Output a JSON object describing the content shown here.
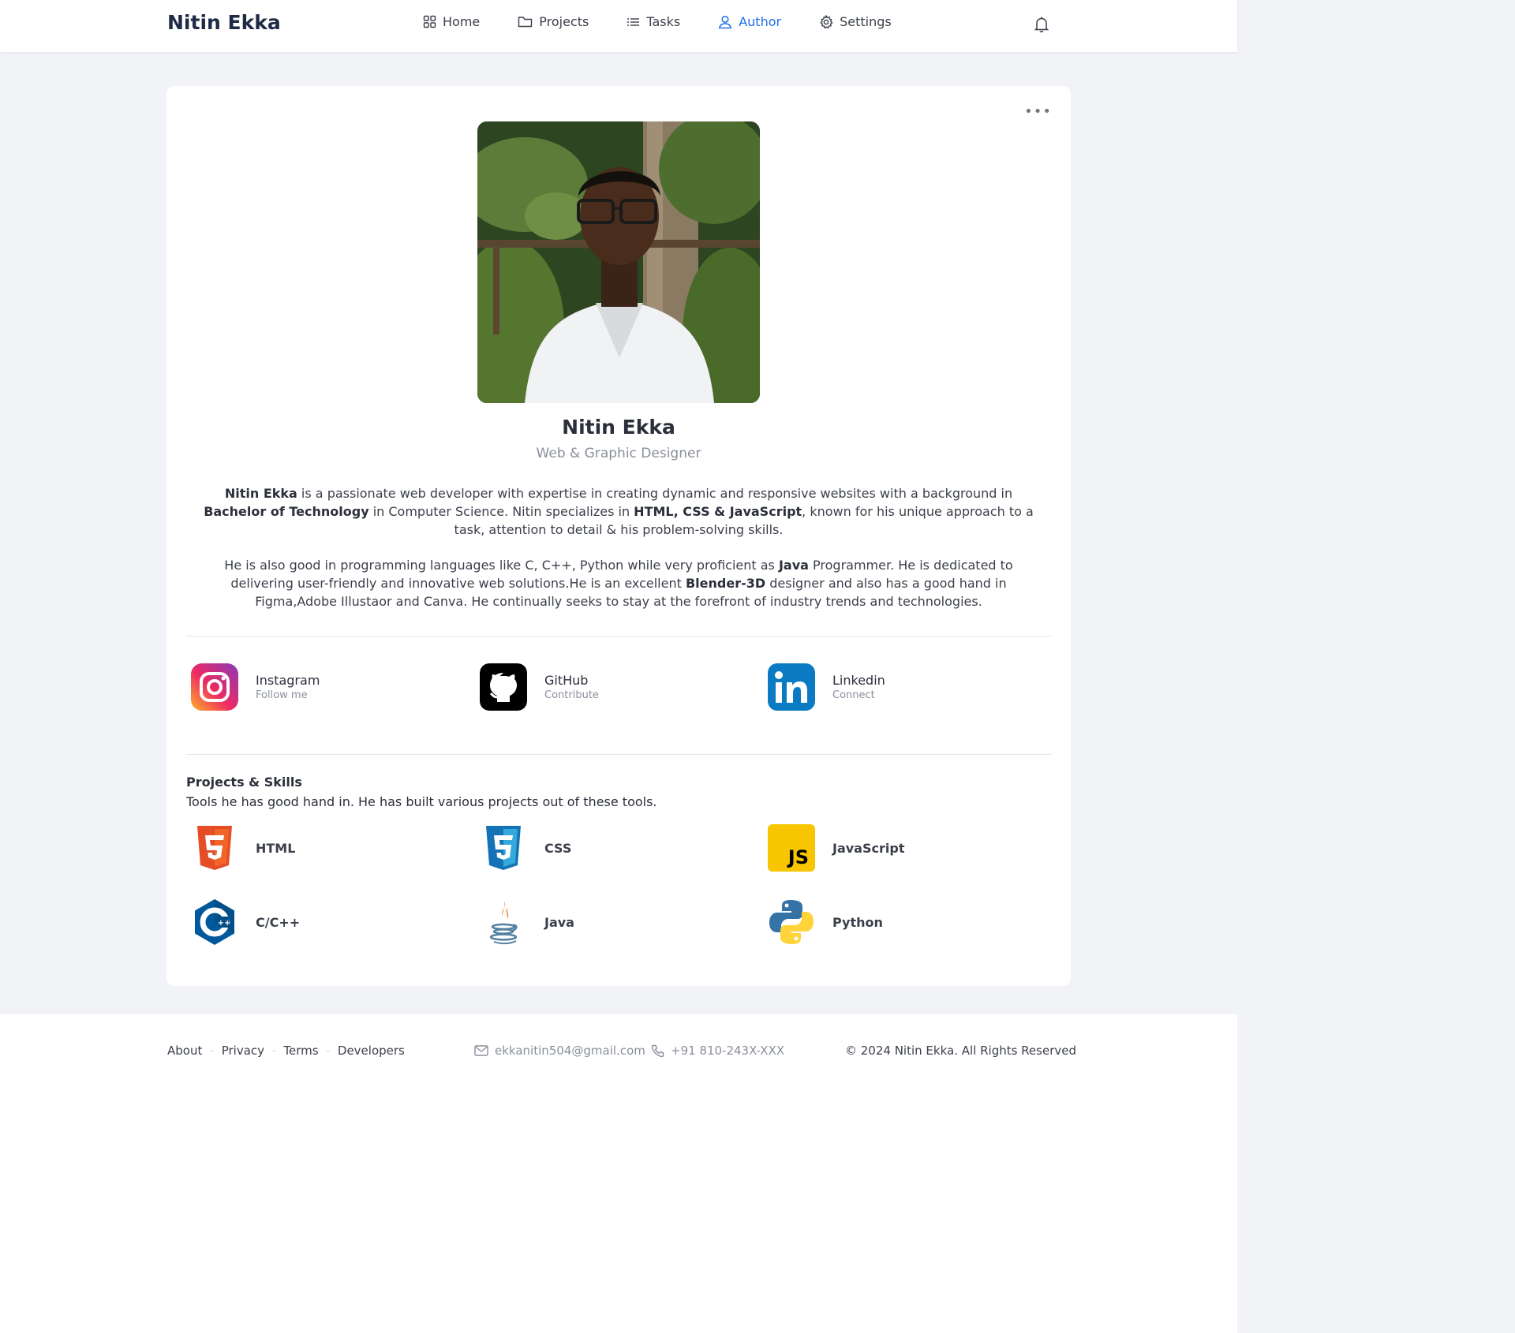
{
  "header": {
    "brand": "Nitin Ekka",
    "nav": [
      {
        "label": "Home",
        "icon": "grid-icon"
      },
      {
        "label": "Projects",
        "icon": "folder-icon"
      },
      {
        "label": "Tasks",
        "icon": "list-icon"
      },
      {
        "label": "Author",
        "icon": "user-icon",
        "active": true
      },
      {
        "label": "Settings",
        "icon": "gear-icon"
      }
    ],
    "accent": "#1f6fe6"
  },
  "profile": {
    "name": "Nitin Ekka",
    "role": "Web & Graphic Designer",
    "bio1": {
      "p1": "Nitin Ekka",
      "p2": " is a passionate web developer with expertise in creating dynamic and responsive websites with a background in ",
      "p3": "Bachelor of Technology",
      "p4": " in Computer Science. Nitin specializes in ",
      "p5": "HTML, CSS & JavaScript",
      "p6": ", known for his unique approach to a task, attention to detail & his problem-solving skills."
    },
    "bio2": {
      "p1": "He is also good in programming languages like C, C++, Python while very proficient as ",
      "p2": "Java",
      "p3": " Programmer. He is dedicated to delivering user-friendly and innovative web solutions.He is an excellent ",
      "p4": "Blender-3D",
      "p5": " designer and also has a good hand in Figma,Adobe Illustaor and Canva. He continually seeks to stay at the forefront of industry trends and technologies."
    }
  },
  "social": [
    {
      "title": "Instagram",
      "sub": "Follow me"
    },
    {
      "title": "GitHub",
      "sub": "Contribute"
    },
    {
      "title": "Linkedin",
      "sub": "Connect"
    }
  ],
  "skills_section": {
    "title": "Projects & Skills",
    "subtitle": "Tools he has good hand in. He has built various projects out of these tools.",
    "items": [
      {
        "label": "HTML"
      },
      {
        "label": "CSS"
      },
      {
        "label": "JavaScript"
      },
      {
        "label": "C/C++"
      },
      {
        "label": "Java"
      },
      {
        "label": "Python"
      }
    ]
  },
  "footer": {
    "links": [
      "About",
      "Privacy",
      "Terms",
      "Developers"
    ],
    "separator": "-",
    "email": "ekkanitin504@gmail.com",
    "phone": "+91 810-243X-XXX",
    "copyright": "© 2024 Nitin Ekka. All Rights Reserved"
  }
}
